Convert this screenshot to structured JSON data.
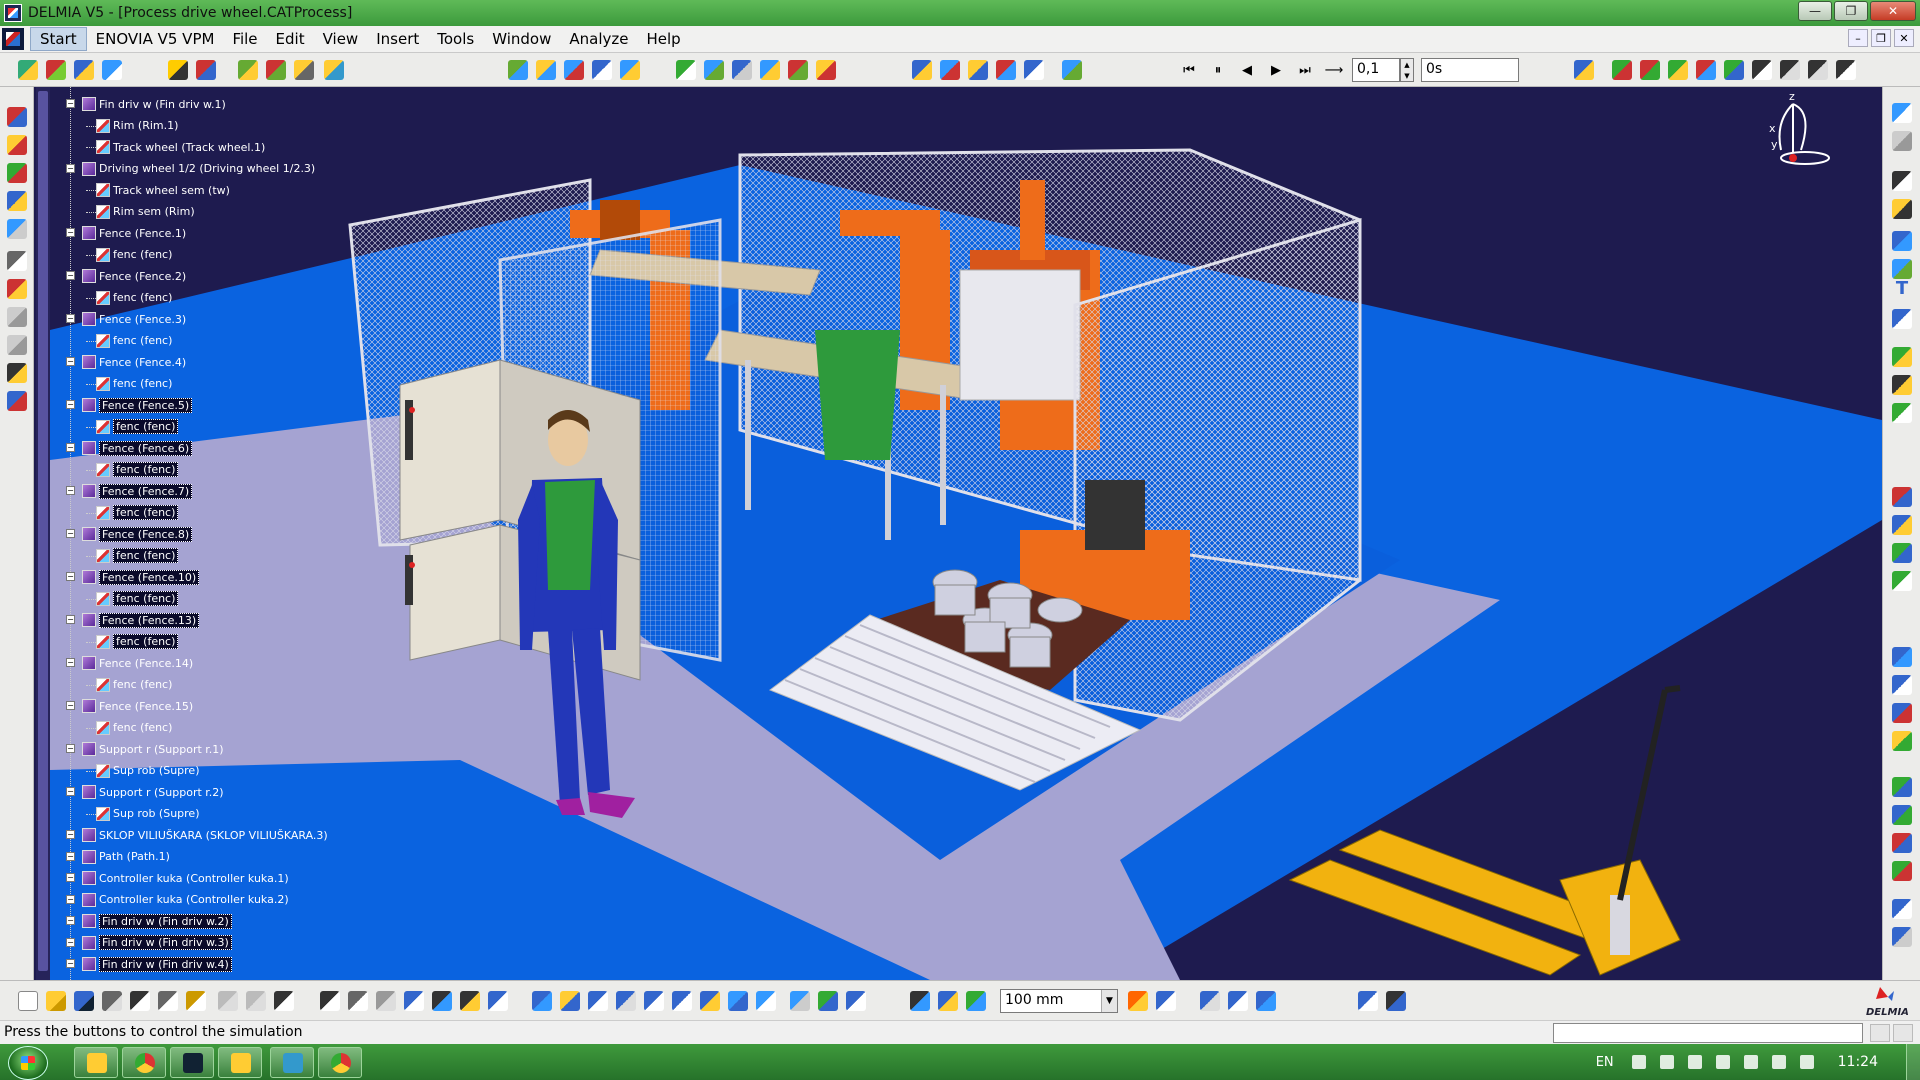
{
  "window": {
    "title": "DELMIA V5 - [Process drive wheel.CATProcess]",
    "controls": {
      "minimize": "—",
      "maximize": "❐",
      "close": "✕"
    }
  },
  "menu": {
    "items": [
      "Start",
      "ENOVIA V5 VPM",
      "File",
      "Edit",
      "View",
      "Insert",
      "Tools",
      "Window",
      "Analyze",
      "Help"
    ],
    "mdi_controls": {
      "minimize": "–",
      "restore": "❐",
      "close": "✕"
    }
  },
  "simulation": {
    "step_value": "0,1",
    "time_value": "0s",
    "buttons": {
      "jump_start": "⏮",
      "pause": "⏸",
      "step_back": "◀",
      "play": "▶",
      "jump_end": "⏭",
      "loop": "⟶"
    }
  },
  "spec_tree": {
    "rows": [
      {
        "label": "Fin driv w (Fin driv w.1)",
        "type": "product",
        "level": 0,
        "highlight": false
      },
      {
        "label": "Rim (Rim.1)",
        "type": "part",
        "level": 1,
        "highlight": false
      },
      {
        "label": "Track wheel (Track wheel.1)",
        "type": "part",
        "level": 1,
        "highlight": false
      },
      {
        "label": "Driving wheel 1/2 (Driving wheel 1/2.3)",
        "type": "product",
        "level": 0,
        "highlight": false
      },
      {
        "label": "Track wheel sem (tw)",
        "type": "part",
        "level": 1,
        "highlight": false
      },
      {
        "label": "Rim sem (Rim)",
        "type": "part",
        "level": 1,
        "highlight": false
      },
      {
        "label": "Fence (Fence.1)",
        "type": "product",
        "level": 0,
        "highlight": false
      },
      {
        "label": "fenc (fenc)",
        "type": "part",
        "level": 1,
        "highlight": false
      },
      {
        "label": "Fence (Fence.2)",
        "type": "product",
        "level": 0,
        "highlight": false
      },
      {
        "label": "fenc (fenc)",
        "type": "part",
        "level": 1,
        "highlight": false
      },
      {
        "label": "Fence (Fence.3)",
        "type": "product",
        "level": 0,
        "highlight": false
      },
      {
        "label": "fenc (fenc)",
        "type": "part",
        "level": 1,
        "highlight": false
      },
      {
        "label": "Fence (Fence.4)",
        "type": "product",
        "level": 0,
        "highlight": false
      },
      {
        "label": "fenc (fenc)",
        "type": "part",
        "level": 1,
        "highlight": false
      },
      {
        "label": "Fence (Fence.5)",
        "type": "product",
        "level": 0,
        "highlight": true
      },
      {
        "label": "fenc (fenc)",
        "type": "part",
        "level": 1,
        "highlight": true
      },
      {
        "label": "Fence (Fence.6)",
        "type": "product",
        "level": 0,
        "highlight": true
      },
      {
        "label": "fenc (fenc)",
        "type": "part",
        "level": 1,
        "highlight": true
      },
      {
        "label": "Fence (Fence.7)",
        "type": "product",
        "level": 0,
        "highlight": true
      },
      {
        "label": "fenc (fenc)",
        "type": "part",
        "level": 1,
        "highlight": true
      },
      {
        "label": "Fence (Fence.8)",
        "type": "product",
        "level": 0,
        "highlight": true
      },
      {
        "label": "fenc (fenc)",
        "type": "part",
        "level": 1,
        "highlight": true
      },
      {
        "label": "Fence (Fence.10)",
        "type": "product",
        "level": 0,
        "highlight": true
      },
      {
        "label": "fenc (fenc)",
        "type": "part",
        "level": 1,
        "highlight": true
      },
      {
        "label": "Fence (Fence.13)",
        "type": "product",
        "level": 0,
        "highlight": true
      },
      {
        "label": "fenc (fenc)",
        "type": "part",
        "level": 1,
        "highlight": true
      },
      {
        "label": "Fence (Fence.14)",
        "type": "product",
        "level": 0,
        "highlight": false
      },
      {
        "label": "fenc (fenc)",
        "type": "part",
        "level": 1,
        "highlight": false
      },
      {
        "label": "Fence (Fence.15)",
        "type": "product",
        "level": 0,
        "highlight": false
      },
      {
        "label": "fenc (fenc)",
        "type": "part",
        "level": 1,
        "highlight": false
      },
      {
        "label": "Support r (Support r.1)",
        "type": "product",
        "level": 0,
        "highlight": false
      },
      {
        "label": "Sup rob (Supre)",
        "type": "part",
        "level": 1,
        "highlight": false
      },
      {
        "label": "Support r (Support r.2)",
        "type": "product",
        "level": 0,
        "highlight": false
      },
      {
        "label": "Sup rob (Supre)",
        "type": "part",
        "level": 1,
        "highlight": false
      },
      {
        "label": "SKLOP VILIUŠKARA (SKLOP VILIUŠKARA.3)",
        "type": "product",
        "level": 0,
        "highlight": false
      },
      {
        "label": "Path (Path.1)",
        "type": "product",
        "level": 0,
        "highlight": false
      },
      {
        "label": "Controller kuka (Controller kuka.1)",
        "type": "product",
        "level": 0,
        "highlight": false
      },
      {
        "label": "Controller kuka (Controller kuka.2)",
        "type": "product",
        "level": 0,
        "highlight": false
      },
      {
        "label": "Fin driv w (Fin driv w.2)",
        "type": "product",
        "level": 0,
        "highlight": true
      },
      {
        "label": "Fin driv w (Fin driv w.3)",
        "type": "product",
        "level": 0,
        "highlight": true
      },
      {
        "label": "Fin driv w (Fin driv w.4)",
        "type": "product",
        "level": 0,
        "highlight": true
      }
    ]
  },
  "compass": {
    "x": "x",
    "y": "y",
    "z": "z"
  },
  "bottom_toolbar": {
    "unit": "100 mm",
    "brand": "DELMIA"
  },
  "status": {
    "message": "Press the buttons to control the simulation"
  },
  "taskbar": {
    "language": "EN",
    "clock": "11:24"
  },
  "colors": {
    "background": "#1e1b4f",
    "floor_blue": "#0a63e0",
    "floor_grey": "#a5a3d2",
    "robot_orange": "#ee6c1a",
    "forklift_yellow": "#f2b20f"
  }
}
